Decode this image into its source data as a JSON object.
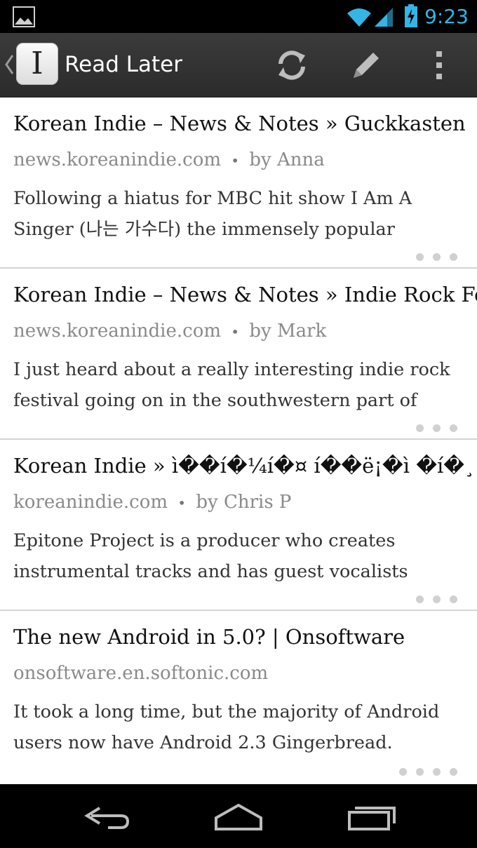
{
  "status_bar": {
    "time": "9:23",
    "icons": [
      "image-notification-icon",
      "wifi-icon",
      "signal-icon",
      "battery-charging-icon"
    ],
    "accent_color": "#33b5e5"
  },
  "action_bar": {
    "title": "Read Later",
    "app_icon_letter": "I",
    "actions": [
      "refresh-icon",
      "edit-icon",
      "overflow-menu-icon"
    ]
  },
  "articles": [
    {
      "title": "Korean Indie – News & Notes » Guckkasten",
      "domain": "news.koreanindie.com",
      "separator": "•",
      "author": "by Anna",
      "snippet": "Following a hiatus for MBC hit show I Am A Singer (나는 가수다) the immensely popular"
    },
    {
      "title": "Korean Indie – News & Notes » Indie Rock Fe",
      "domain": "news.koreanindie.com",
      "separator": "•",
      "author": "by Mark",
      "snippet": "I just heard about a really interesting indie rock festival going on in the southwestern part of"
    },
    {
      "title": "Korean Indie » ì��í�¼í�¤ í��ë¡�ì �í�¸ (",
      "domain": "koreanindie.com",
      "separator": "•",
      "author": "by Chris P",
      "snippet": "Epitone Project is a producer who creates instrumental tracks and has guest vocalists"
    },
    {
      "title": "The new Android in 5.0? | Onsoftware",
      "domain": "onsoftware.en.softonic.com",
      "separator": "",
      "author": "",
      "snippet": "It took a long time, but the majority of Android users now have Android 2.3 Gingerbread."
    }
  ],
  "nav_bar": {
    "buttons": [
      "back-icon",
      "home-icon",
      "recents-icon"
    ]
  }
}
